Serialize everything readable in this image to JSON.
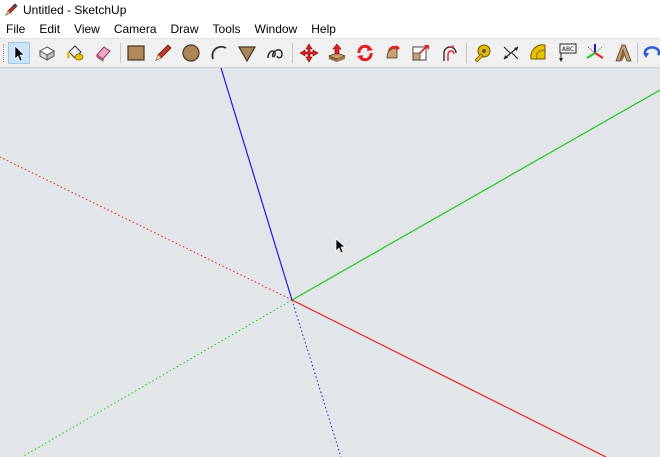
{
  "window": {
    "title": "Untitled - SketchUp",
    "icon": "sketchup-pencil-icon"
  },
  "menu": {
    "items": [
      "File",
      "Edit",
      "View",
      "Camera",
      "Draw",
      "Tools",
      "Window",
      "Help"
    ]
  },
  "toolbar": {
    "tools": [
      {
        "name": "select-tool",
        "icon": "arrow-cursor-icon",
        "selected": true
      },
      {
        "name": "make-component-tool",
        "icon": "component-icon"
      },
      {
        "name": "paint-bucket-tool",
        "icon": "paint-bucket-icon"
      },
      {
        "name": "eraser-tool",
        "icon": "eraser-icon"
      },
      {
        "name": "rectangle-tool",
        "icon": "rectangle-icon"
      },
      {
        "name": "line-tool",
        "icon": "pencil-icon"
      },
      {
        "name": "circle-tool",
        "icon": "circle-icon"
      },
      {
        "name": "arc-tool",
        "icon": "arc-icon"
      },
      {
        "name": "polygon-tool",
        "icon": "polygon-icon"
      },
      {
        "name": "freehand-tool",
        "icon": "freehand-icon"
      },
      {
        "name": "move-tool",
        "icon": "move-icon"
      },
      {
        "name": "push-pull-tool",
        "icon": "push-pull-icon"
      },
      {
        "name": "rotate-tool",
        "icon": "rotate-icon"
      },
      {
        "name": "follow-me-tool",
        "icon": "follow-me-icon"
      },
      {
        "name": "scale-tool",
        "icon": "scale-icon"
      },
      {
        "name": "offset-tool",
        "icon": "offset-icon"
      },
      {
        "name": "tape-measure-tool",
        "icon": "tape-measure-icon"
      },
      {
        "name": "dimension-tool",
        "icon": "dimension-icon"
      },
      {
        "name": "protractor-tool",
        "icon": "protractor-icon"
      },
      {
        "name": "text-tool",
        "icon": "text-label-icon",
        "label": "ABC"
      },
      {
        "name": "axes-tool",
        "icon": "axes-icon"
      },
      {
        "name": "3d-text-tool",
        "icon": "3d-text-icon"
      },
      {
        "name": "orbit-tool",
        "icon": "orbit-icon"
      }
    ]
  },
  "viewport": {
    "background": "#e3e6e8",
    "axis_colors": {
      "red": "#e02020",
      "green": "#1ec81e",
      "blue": "#1c1ce0"
    },
    "cursor": "arrow-cursor"
  },
  "colors": {
    "toolbar_bg": "#f0f0f0",
    "selected_tool_bg": "#cce4f7"
  }
}
